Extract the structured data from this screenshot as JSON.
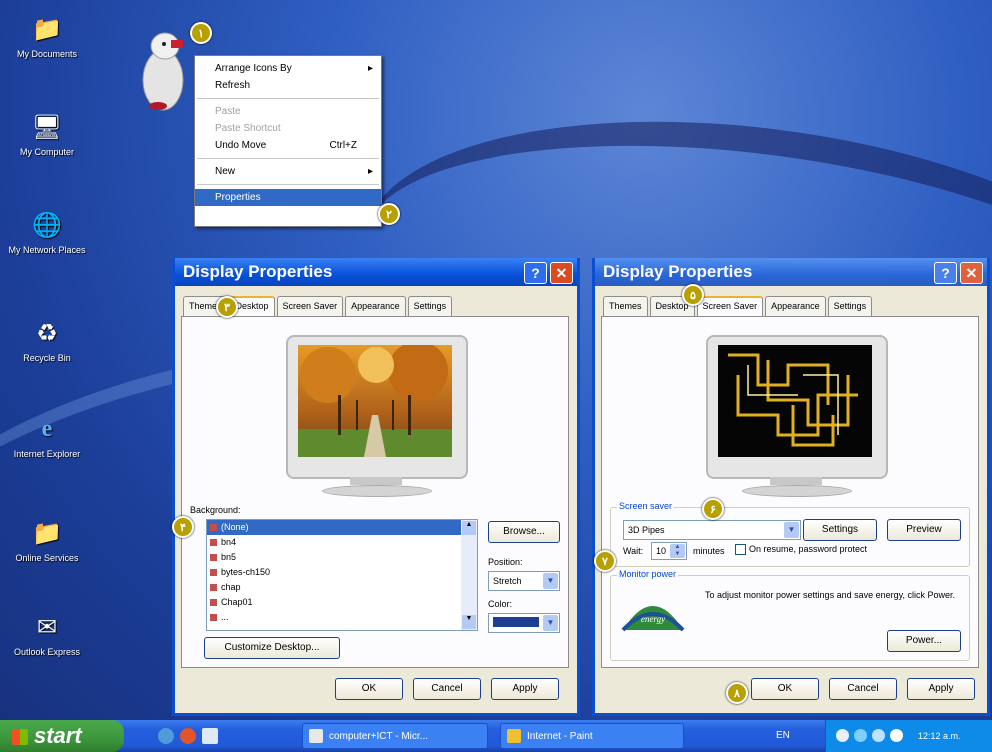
{
  "desktop": {
    "icons": [
      {
        "label": "My Documents"
      },
      {
        "label": "My Computer"
      },
      {
        "label": "My Network Places"
      },
      {
        "label": "Recycle Bin"
      },
      {
        "label": "Internet Explorer"
      },
      {
        "label": "Online Services"
      },
      {
        "label": "Outlook Express"
      }
    ]
  },
  "markers": [
    "۱",
    "۲",
    "۳",
    "۴",
    "۵",
    "۶",
    "۷",
    "۸"
  ],
  "context_menu": {
    "items": [
      {
        "label": "Arrange Icons By",
        "submenu": true
      },
      {
        "label": "Refresh"
      },
      {
        "label": "Paste",
        "disabled": true
      },
      {
        "label": "Paste Shortcut",
        "disabled": true
      },
      {
        "label": "Undo Move",
        "shortcut": "Ctrl+Z"
      },
      {
        "label": "New",
        "submenu": true
      },
      {
        "label": "Properties",
        "selected": true
      }
    ]
  },
  "dialog_left": {
    "title": "Display Properties",
    "tabs": [
      "Themes",
      "Desktop",
      "Screen Saver",
      "Appearance",
      "Settings"
    ],
    "active_tab": "Desktop",
    "background_label": "Background:",
    "background_items": [
      "(None)",
      "bn4",
      "bn5",
      "bytes-ch150",
      "chap",
      "Chap01",
      "..."
    ],
    "browse_button": "Browse...",
    "position_label": "Position:",
    "position_value": "Stretch",
    "color_label": "Color:",
    "color_value": "#1c3f94",
    "customize_button": "Customize Desktop...",
    "ok": "OK",
    "cancel": "Cancel",
    "apply": "Apply"
  },
  "dialog_right": {
    "title": "Display Properties",
    "tabs": [
      "Themes",
      "Desktop",
      "Screen Saver",
      "Appearance",
      "Settings"
    ],
    "active_tab": "Screen Saver",
    "screensaver_group": "Screen saver",
    "screensaver_value": "3D Pipes",
    "settings_button": "Settings",
    "preview_button": "Preview",
    "wait_label": "Wait:",
    "wait_value": "10",
    "minutes_label": "minutes",
    "resume_label": "On resume, password protect",
    "monitor_group": "Monitor power",
    "monitor_text": "To adjust monitor power settings and save energy, click Power.",
    "energy_logo": "energy",
    "power_button": "Power...",
    "ok": "OK",
    "cancel": "Cancel",
    "apply": "Apply"
  },
  "taskbar": {
    "start": "start",
    "tasks": [
      "computer+ICT - Micr...",
      "Internet - Paint"
    ],
    "lang": "EN",
    "clock": "12:12 a.m."
  }
}
